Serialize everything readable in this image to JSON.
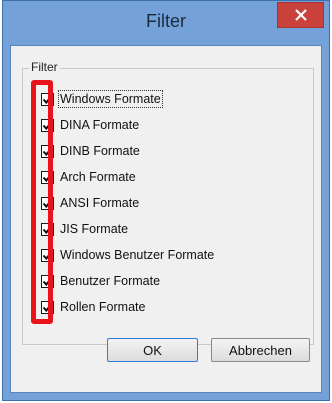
{
  "window": {
    "title": "Filter",
    "close_icon": "close-icon"
  },
  "group": {
    "label": "Filter"
  },
  "checkboxes": [
    {
      "label": "Windows Formate",
      "checked": true
    },
    {
      "label": "DINA Formate",
      "checked": true
    },
    {
      "label": "DINB Formate",
      "checked": true
    },
    {
      "label": "Arch Formate",
      "checked": true
    },
    {
      "label": "ANSI Formate",
      "checked": true
    },
    {
      "label": "JIS Formate",
      "checked": true
    },
    {
      "label": "Windows Benutzer Formate",
      "checked": true
    },
    {
      "label": "Benutzer Formate",
      "checked": true
    },
    {
      "label": "Rollen Formate",
      "checked": true
    }
  ],
  "buttons": {
    "ok": "OK",
    "cancel": "Abbrechen"
  },
  "colors": {
    "frame": "#74a1d8",
    "close": "#c9423b",
    "annotation": "#e8141a"
  }
}
